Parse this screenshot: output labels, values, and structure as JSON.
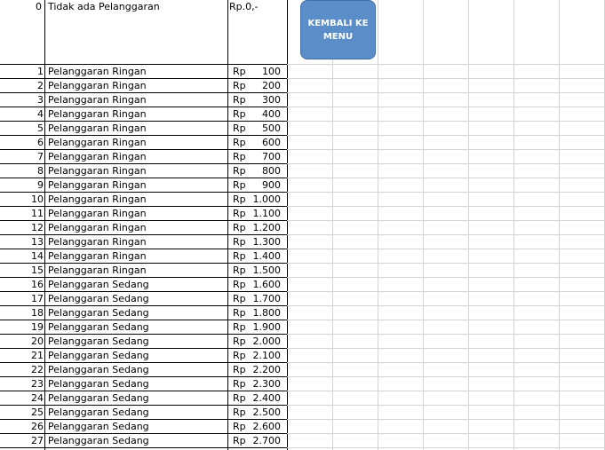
{
  "top_row": {
    "no": "0",
    "label": "Tidak ada Pelanggaran",
    "fine": "Rp.0,-"
  },
  "menu_button": {
    "label": "KEMBALI KE MENU"
  },
  "currency": "Rp",
  "rows": [
    {
      "no": "1",
      "label": "Pelanggaran Ringan",
      "amount": "100"
    },
    {
      "no": "2",
      "label": "Pelanggaran Ringan",
      "amount": "200"
    },
    {
      "no": "3",
      "label": "Pelanggaran Ringan",
      "amount": "300"
    },
    {
      "no": "4",
      "label": "Pelanggaran Ringan",
      "amount": "400"
    },
    {
      "no": "5",
      "label": "Pelanggaran Ringan",
      "amount": "500"
    },
    {
      "no": "6",
      "label": "Pelanggaran Ringan",
      "amount": "600"
    },
    {
      "no": "7",
      "label": "Pelanggaran Ringan",
      "amount": "700"
    },
    {
      "no": "8",
      "label": "Pelanggaran Ringan",
      "amount": "800"
    },
    {
      "no": "9",
      "label": "Pelanggaran Ringan",
      "amount": "900"
    },
    {
      "no": "10",
      "label": "Pelanggaran Ringan",
      "amount": "1.000"
    },
    {
      "no": "11",
      "label": "Pelanggaran Ringan",
      "amount": "1.100"
    },
    {
      "no": "12",
      "label": "Pelanggaran Ringan",
      "amount": "1.200"
    },
    {
      "no": "13",
      "label": "Pelanggaran Ringan",
      "amount": "1.300"
    },
    {
      "no": "14",
      "label": "Pelanggaran Ringan",
      "amount": "1.400"
    },
    {
      "no": "15",
      "label": "Pelanggaran Ringan",
      "amount": "1.500"
    },
    {
      "no": "16",
      "label": "Pelanggaran Sedang",
      "amount": "1.600"
    },
    {
      "no": "17",
      "label": "Pelanggaran Sedang",
      "amount": "1.700"
    },
    {
      "no": "18",
      "label": "Pelanggaran Sedang",
      "amount": "1.800"
    },
    {
      "no": "19",
      "label": "Pelanggaran Sedang",
      "amount": "1.900"
    },
    {
      "no": "20",
      "label": "Pelanggaran Sedang",
      "amount": "2.000"
    },
    {
      "no": "21",
      "label": "Pelanggaran Sedang",
      "amount": "2.100"
    },
    {
      "no": "22",
      "label": "Pelanggaran Sedang",
      "amount": "2.200"
    },
    {
      "no": "23",
      "label": "Pelanggaran Sedang",
      "amount": "2.300"
    },
    {
      "no": "24",
      "label": "Pelanggaran Sedang",
      "amount": "2.400"
    },
    {
      "no": "25",
      "label": "Pelanggaran Sedang",
      "amount": "2.500"
    },
    {
      "no": "26",
      "label": "Pelanggaran Sedang",
      "amount": "2.600"
    },
    {
      "no": "27",
      "label": "Pelanggaran Sedang",
      "amount": "2.700"
    }
  ],
  "colors": {
    "button_fill": "#5b8ec8",
    "grid": "#d4d4d4",
    "border": "#000000"
  }
}
